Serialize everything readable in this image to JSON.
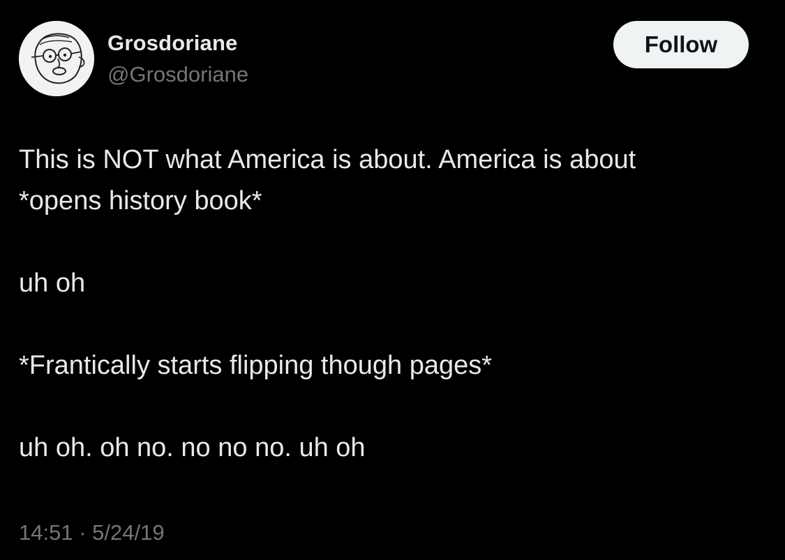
{
  "author": {
    "display_name": "Grosdoriane",
    "handle": "@Grosdoriane",
    "avatar_icon": "sketch-face-avatar"
  },
  "follow_button": {
    "label": "Follow"
  },
  "tweet": {
    "lines": [
      "This is NOT what America is about. America is about",
      "*opens history book*",
      "",
      "uh oh",
      "",
      "*Frantically starts flipping though pages*",
      "",
      "uh oh. oh no. no no no. uh oh"
    ]
  },
  "meta": {
    "timestamp": "14:51 · 5/24/19"
  },
  "colors": {
    "background": "#000000",
    "primary_text": "#e7e9ea",
    "secondary_text": "#71767b",
    "button_bg": "#eff3f4",
    "button_text": "#0f1419"
  }
}
